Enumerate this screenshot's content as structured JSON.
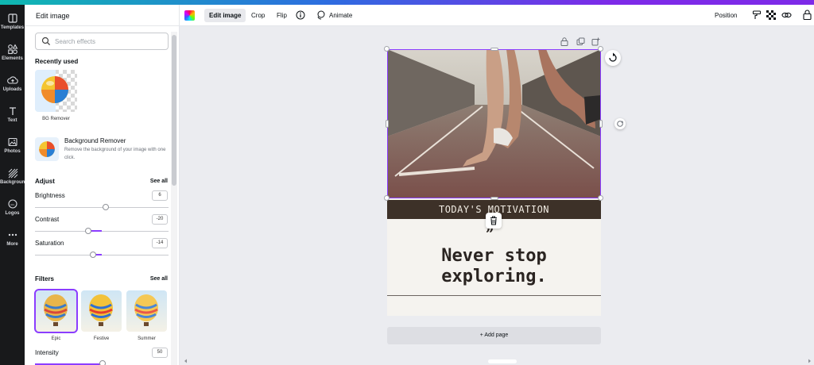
{
  "rail": [
    {
      "label": "Templates",
      "icon": "templates-icon"
    },
    {
      "label": "Elements",
      "icon": "elements-icon"
    },
    {
      "label": "Uploads",
      "icon": "uploads-icon"
    },
    {
      "label": "Text",
      "icon": "text-icon"
    },
    {
      "label": "Photos",
      "icon": "photos-icon"
    },
    {
      "label": "Background",
      "icon": "background-icon"
    },
    {
      "label": "Logos",
      "icon": "logos-icon"
    },
    {
      "label": "More",
      "icon": "more-icon"
    }
  ],
  "panel": {
    "title": "Edit image",
    "search_placeholder": "Search effects",
    "recently_used": {
      "heading": "Recently used",
      "items": [
        {
          "label": "BG Remover"
        }
      ]
    },
    "bg_remover": {
      "title": "Background Remover",
      "description": "Remove the background of your image with one click."
    },
    "adjust": {
      "heading": "Adjust",
      "see_all": "See all",
      "brightness": {
        "label": "Brightness",
        "value": "6"
      },
      "contrast": {
        "label": "Contrast",
        "value": "-20"
      },
      "saturation": {
        "label": "Saturation",
        "value": "-14"
      }
    },
    "filters": {
      "heading": "Filters",
      "see_all": "See all",
      "items": [
        {
          "label": "Epic",
          "selected": true
        },
        {
          "label": "Festive",
          "selected": false
        },
        {
          "label": "Summer",
          "selected": false
        }
      ],
      "intensity": {
        "label": "Intensity",
        "value": "50"
      }
    }
  },
  "toolbar": {
    "edit_image": "Edit image",
    "crop": "Crop",
    "flip": "Flip",
    "animate": "Animate",
    "position": "Position"
  },
  "canvas": {
    "banner_text": "TODAY'S MOTIVATION",
    "quote_mark": "”",
    "quote_text": "Never stop\nexploring.",
    "add_page": "+ Add page"
  },
  "colors": {
    "accent": "#8b3dff",
    "banner_bg": "#3d3128",
    "rail_bg": "#18191b"
  }
}
